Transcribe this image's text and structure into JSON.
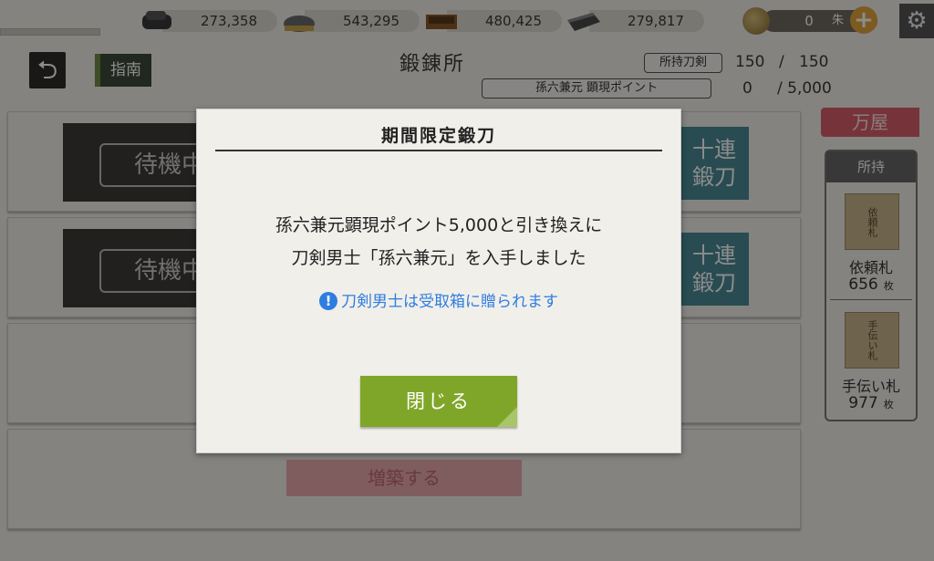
{
  "resources": [
    {
      "icon": "charcoal-icon",
      "value": "273,358"
    },
    {
      "icon": "steel-icon",
      "value": "543,295"
    },
    {
      "icon": "coolant-icon",
      "value": "480,425"
    },
    {
      "icon": "whetstone-icon",
      "value": "279,817"
    }
  ],
  "currency": {
    "value": "0",
    "unit": "朱"
  },
  "header": {
    "guide_label": "指南",
    "title": "鍛錬所",
    "owned_tag": "所持刀剣",
    "owned_current": "150",
    "owned_sep": "/",
    "owned_max": "150",
    "points_tag": "孫六兼元 顕現ポイント",
    "points_current": "0",
    "points_max": "/ 5,000"
  },
  "slots": [
    {
      "status": "待機中",
      "ten_label_1": "十連",
      "ten_label_2": "鍛刀"
    },
    {
      "status": "待機中",
      "ten_label_1": "十連",
      "ten_label_2": "鍛刀"
    }
  ],
  "expand_label": "増築する",
  "sidebar": {
    "shop_label": "万屋",
    "inventory_title": "所持",
    "items": [
      {
        "ticket_text": "依頼札",
        "name": "依頼札",
        "count": "656",
        "unit": "枚"
      },
      {
        "ticket_text": "手伝い札",
        "name": "手伝い札",
        "count": "977",
        "unit": "枚"
      }
    ]
  },
  "dialog": {
    "title": "期間限定鍛刀",
    "line1": "孫六兼元顕現ポイント5,000と引き換えに",
    "line2": "刀剣男士「孫六兼元」を入手しました",
    "note": "刀剣男士は受取箱に贈られます",
    "close_label": "閉じる"
  },
  "colors": {
    "accent_green": "#80a629",
    "note_blue": "#2f7de0",
    "shop_red": "#d85f6a"
  }
}
